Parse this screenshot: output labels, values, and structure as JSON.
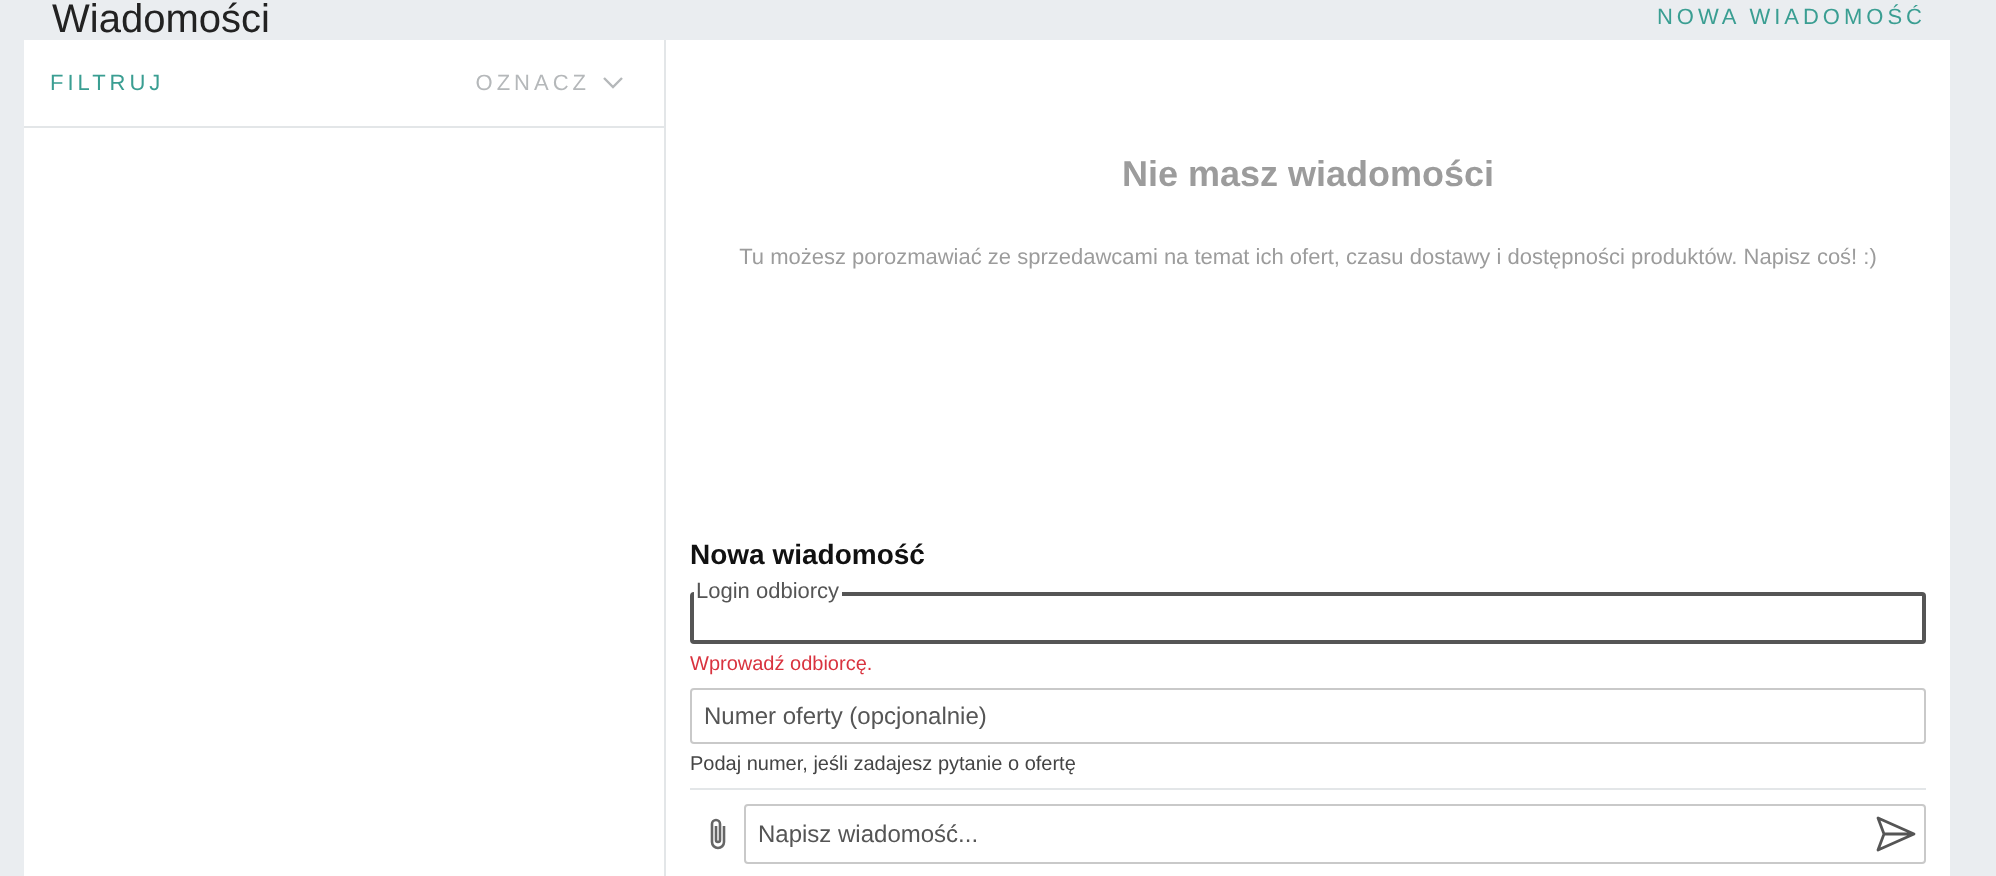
{
  "header": {
    "title": "Wiadomości",
    "new_message_link": "NOWA WIADOMOŚĆ"
  },
  "sidebar": {
    "filter": "FILTRUJ",
    "mark": "OZNACZ"
  },
  "empty_state": {
    "title": "Nie masz wiadomości",
    "text": "Tu możesz porozmawiać ze sprzedawcami na temat ich ofert, czasu dostawy i dostępności produktów. Napisz coś! :)"
  },
  "compose": {
    "title": "Nowa wiadomość",
    "recipient": {
      "label": "Login odbiorcy",
      "error": "Wprowadź odbiorcę."
    },
    "offer": {
      "placeholder": "Numer oferty (opcjonalnie)",
      "hint": "Podaj numer, jeśli zadajesz pytanie o ofertę"
    },
    "message": {
      "placeholder": "Napisz wiadomość..."
    }
  }
}
